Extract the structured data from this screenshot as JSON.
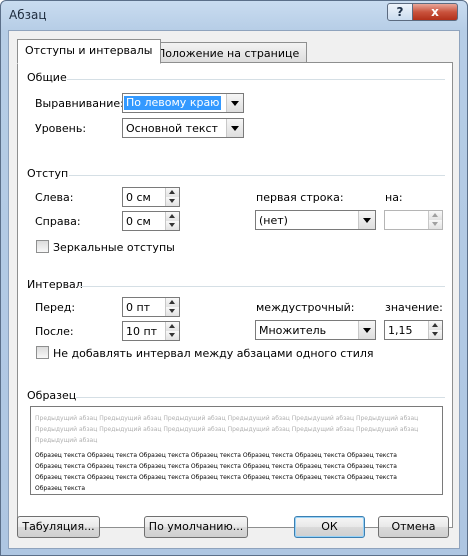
{
  "window": {
    "title": "Абзац",
    "help_label": "?",
    "close_label": "x"
  },
  "tabs": [
    {
      "label": "Отступы и интервалы",
      "active": true
    },
    {
      "label": "Положение на странице",
      "active": false
    }
  ],
  "general": {
    "title": "Общие",
    "alignment_label": "Выравнивание:",
    "alignment_value": "По левому краю",
    "level_label": "Уровень:",
    "level_value": "Основной текст"
  },
  "indent": {
    "title": "Отступ",
    "left_label": "Слева:",
    "left_value": "0 см",
    "right_label": "Справа:",
    "right_value": "0 см",
    "first_line_label": "первая строка:",
    "first_line_value": "(нет)",
    "by_label": "на:",
    "by_value": "",
    "mirror_label": "Зеркальные отступы",
    "mirror_checked": false
  },
  "spacing": {
    "title": "Интервал",
    "before_label": "Перед:",
    "before_value": "0 пт",
    "after_label": "После:",
    "after_value": "10 пт",
    "line_spacing_label": "междустрочный:",
    "line_spacing_value": "Множитель",
    "at_label": "значение:",
    "at_value": "1,15",
    "no_space_label": "Не добавлять интервал между абзацами одного стиля",
    "no_space_checked": false
  },
  "preview": {
    "title": "Образец",
    "prev_lines": [
      "Предыдущий абзац Предыдущий абзац Предыдущий абзац Предыдущий абзац Предыдущий абзац Предыдущий абзац",
      "Предыдущий абзац Предыдущий абзац Предыдущий абзац Предыдущий абзац Предыдущий абзац Предыдущий абзац",
      "Предыдущий абзац"
    ],
    "sample_lines": [
      "Образец текста Образец текста Образец текста Образец текста Образец текста Образец текста Образец текста",
      "Образец текста Образец текста Образец текста Образец текста Образец текста Образец текста Образец текста",
      "Образец текста Образец текста Образец текста Образец текста Образец текста Образец текста Образец текста",
      "Образец текста"
    ]
  },
  "buttons": {
    "tabs": "Табуляция...",
    "default": "По умолчанию...",
    "ok": "ОК",
    "cancel": "Отмена"
  }
}
